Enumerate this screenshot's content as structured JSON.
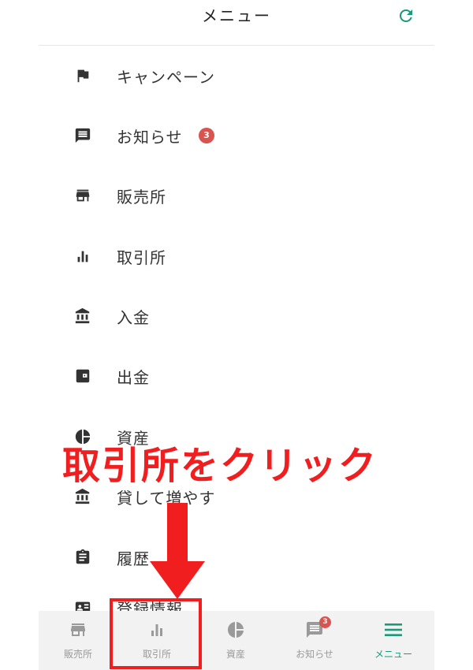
{
  "header": {
    "title": "メニュー"
  },
  "menu": {
    "items": [
      {
        "label": "キャンペーン",
        "icon": "flag-icon"
      },
      {
        "label": "お知らせ",
        "icon": "message-icon",
        "badge": "3"
      },
      {
        "label": "販売所",
        "icon": "store-icon"
      },
      {
        "label": "取引所",
        "icon": "bar-chart-icon"
      },
      {
        "label": "入金",
        "icon": "bank-icon"
      },
      {
        "label": "出金",
        "icon": "wallet-icon"
      },
      {
        "label": "資産",
        "icon": "pie-chart-icon"
      },
      {
        "label": "貸して増やす",
        "icon": "bank-icon"
      },
      {
        "label": "履歴",
        "icon": "clipboard-icon"
      },
      {
        "label": "登録情報",
        "icon": "id-card-icon"
      }
    ]
  },
  "annotation": {
    "text": "取引所をクリック"
  },
  "tabbar": {
    "tabs": [
      {
        "label": "販売所",
        "icon": "store-icon"
      },
      {
        "label": "取引所",
        "icon": "bar-chart-icon"
      },
      {
        "label": "資産",
        "icon": "pie-chart-icon"
      },
      {
        "label": "お知らせ",
        "icon": "message-icon",
        "badge": "3"
      },
      {
        "label": "メニュー",
        "icon": "hamburger-icon"
      }
    ]
  },
  "colors": {
    "accent": "#1a9a7a",
    "icon": "#333333",
    "inactive": "#9a9a9a",
    "badge": "#d9534f",
    "annotation": "#f01e1e"
  }
}
